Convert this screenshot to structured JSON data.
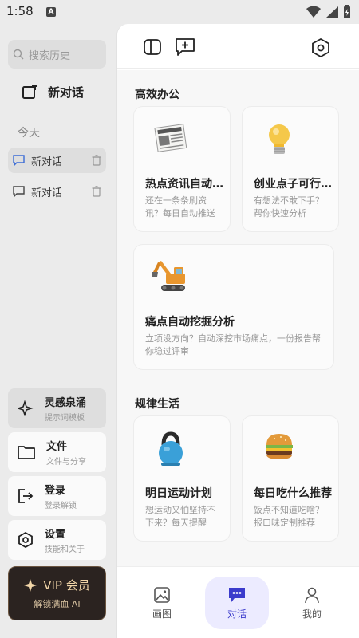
{
  "status": {
    "time": "1:58",
    "notif_badge": "A"
  },
  "drawer": {
    "search_placeholder": "搜索历史",
    "new_chat_label": "新对话",
    "section_today": "今天",
    "history": [
      {
        "label": "新对话",
        "active": true
      },
      {
        "label": "新对话",
        "active": false
      }
    ],
    "buttons": [
      {
        "title": "灵感泉涌",
        "subtitle": "提示词模板",
        "icon": "sparkle-icon"
      },
      {
        "title": "文件",
        "subtitle": "文件与分享",
        "icon": "folder-icon"
      },
      {
        "title": "登录",
        "subtitle": "登录解锁",
        "icon": "login-icon"
      },
      {
        "title": "设置",
        "subtitle": "技能和关于",
        "icon": "settings-icon"
      }
    ],
    "vip": {
      "title": "VIP 会员",
      "subtitle": "解锁满血 AI",
      "icon": "sparkle-icon"
    }
  },
  "main": {
    "categories": [
      {
        "title": "高效办公",
        "cards": [
          {
            "title": "热点资讯自动推送",
            "desc": "还在一条条刷资讯？每日自动推送",
            "icon": "newspaper-icon"
          },
          {
            "title": "创业点子可行性分析",
            "desc": "有想法不敢下手？帮你快速分析",
            "icon": "lightbulb-icon"
          },
          {
            "title": "痛点自动挖掘分析",
            "desc": "立项没方向？自动深挖市场痛点，一份报告帮你稳过评审",
            "icon": "excavator-icon"
          }
        ]
      },
      {
        "title": "规律生活",
        "cards": [
          {
            "title": "明日运动计划",
            "desc": "想运动又怕坚持不下来？每天提醒",
            "icon": "kettlebell-icon"
          },
          {
            "title": "每日吃什么推荐",
            "desc": "饭点不知道吃啥？报口味定制推荐",
            "icon": "burger-icon"
          }
        ]
      }
    ]
  },
  "tabs": [
    {
      "label": "画图",
      "icon": "image-icon",
      "active": false
    },
    {
      "label": "对话",
      "icon": "chat-icon",
      "active": true
    },
    {
      "label": "我的",
      "icon": "user-icon",
      "active": false
    }
  ],
  "colors": {
    "accent": "#3b3bcc",
    "active_tab_bg": "#ecebff",
    "vip_gold": "#f2d6a8"
  }
}
